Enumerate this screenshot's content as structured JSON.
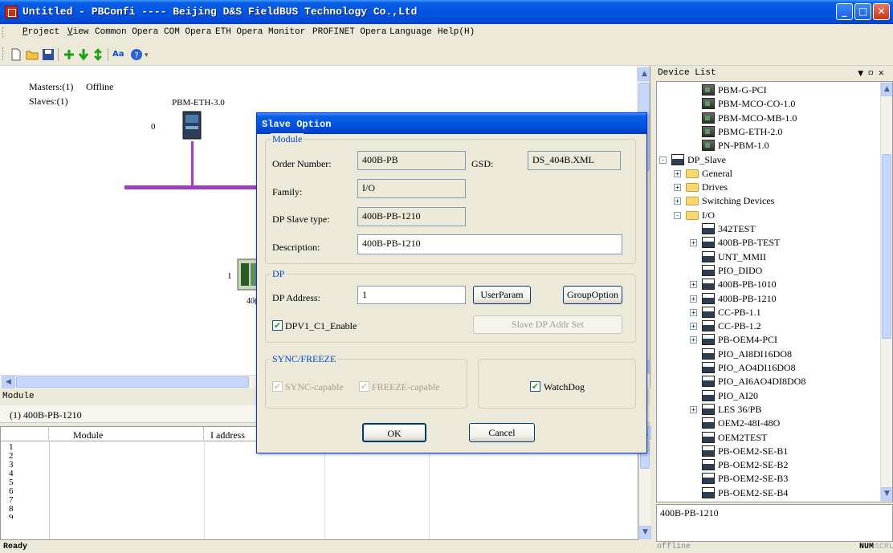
{
  "window": {
    "title": "Untitled - PBConfi ---- Beijing D&S FieldBUS Technology Co.,Ltd"
  },
  "menu": [
    "Project",
    "View",
    "Common Opera",
    "COM Opera",
    "ETH Opera",
    "Monitor",
    "PROFINET Opera",
    "Language",
    "Help(H)"
  ],
  "toolbar": {
    "icons": [
      "new-icon",
      "open-icon",
      "save-icon",
      "add-icon",
      "download-icon",
      "upload-icon",
      "font-icon",
      "help-icon"
    ],
    "aa_label": "Aa"
  },
  "canvas": {
    "masters": "Masters:(1)",
    "status": "Offline",
    "slaves": "Slaves:(1)",
    "master_name": "PBM-ETH-3.0",
    "master_addr": "0",
    "slave_addr": "1",
    "slave_label_partial": "40("
  },
  "module_panel": {
    "header": "Module",
    "selected": "(1) 400B-PB-1210",
    "columns": [
      "Module",
      "I address"
    ],
    "rows": [
      "1",
      "2",
      "3",
      "4",
      "5",
      "6",
      "7",
      "8",
      "9"
    ]
  },
  "device_list": {
    "header": "Device List",
    "items": [
      "PBM-G-PCI",
      "PBM-MCO-CO-1.0",
      "PBM-MCO-MB-1.0",
      "PBMG-ETH-2.0",
      "PN-PBM-1.0",
      "DP_Slave",
      "General",
      "Drives",
      "Switching Devices",
      "I/O",
      "342TEST",
      "400B-PB-TEST",
      "UNT_MMII",
      "PIO_DIDO",
      "400B-PB-1010",
      "400B-PB-1210",
      "CC-PB-1.1",
      "CC-PB-1.2",
      "PB-OEM4-PCI",
      "PIO_AI8DI16DO8",
      "PIO_AO4DI16DO8",
      "PIO_AI6AO4DI8DO8",
      "PIO_AI20",
      "LES 36/PB",
      "OEM2-48I-48O",
      "OEM2TEST",
      "PB-OEM2-SE-B1",
      "PB-OEM2-SE-B2",
      "PB-OEM2-SE-B3",
      "PB-OEM2-SE-B4"
    ],
    "description": "400B-PB-1210"
  },
  "dialog": {
    "title": "Slave Option",
    "module_group": "Module",
    "order_number_label": "Order Number:",
    "order_number": "400B-PB",
    "gsd_label": "GSD:",
    "gsd": "DS_404B.XML",
    "family_label": "Family:",
    "family": "I/O",
    "slave_type_label": "DP Slave type:",
    "slave_type": "400B-PB-1210",
    "description_label": "Description:",
    "description": "400B-PB-1210",
    "dp_group": "DP",
    "dp_address_label": "DP Address:",
    "dp_address": "1",
    "userparam_button": "UserParam",
    "groupoption_button": "GroupOption",
    "dpv1_label": "DPV1_C1_Enable",
    "dpv1_checked": true,
    "slave_dp_addr_button": "Slave DP Addr Set",
    "sync_group": "SYNC/FREEZE",
    "sync_label": "SYNC-capable",
    "freeze_label": "FREEZE-capable",
    "watchdog_label": "WatchDog",
    "watchdog_checked": true,
    "ok_button": "OK",
    "cancel_button": "Cancel"
  },
  "statusbar": {
    "ready": "Ready",
    "mode": "offline",
    "num": "NUM",
    "scrl": "SCRL"
  },
  "colors": {
    "titlebar": "#0054e3",
    "bus_line": "#a040c0",
    "master_line": "#a040c0",
    "group_label": "#0046d5"
  }
}
